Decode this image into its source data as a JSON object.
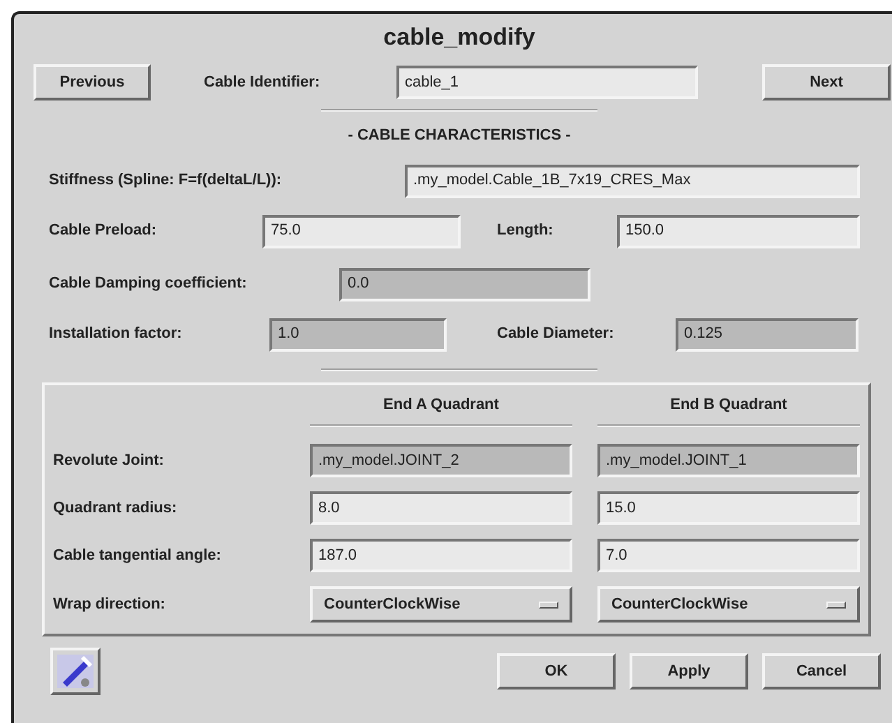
{
  "window": {
    "title": "cable_modify"
  },
  "nav": {
    "previous": "Previous",
    "identifier_label": "Cable Identifier:",
    "identifier": "cable_1",
    "next": "Next"
  },
  "section_title": "- CABLE CHARACTERISTICS -",
  "characteristics": [
    [
      {
        "label": "Stiffness (Spline: F=f(deltaL/L)):",
        "value": ".my_model.Cable_1B_7x19_CRES_Max",
        "editable": true
      }
    ],
    [
      {
        "label": "Cable Preload:",
        "value": "75.0",
        "editable": true
      },
      {
        "label": "Length:",
        "value": "150.0",
        "editable": true
      }
    ],
    [
      {
        "label": "Cable Damping coefficient:",
        "value": "0.0",
        "editable": false
      }
    ],
    [
      {
        "label": "Installation factor:",
        "value": "1.0",
        "editable": false
      },
      {
        "label": "Cable Diameter:",
        "value": "0.125",
        "editable": false
      }
    ]
  ],
  "quadrant": {
    "columns": [
      "End A Quadrant",
      "End B Quadrant"
    ],
    "rows": [
      {
        "label": "Revolute Joint:",
        "kind": "text",
        "values": [
          {
            "value": ".my_model.JOINT_2",
            "editable": false
          },
          {
            "value": ".my_model.JOINT_1",
            "editable": false
          }
        ]
      },
      {
        "label": "Quadrant radius:",
        "kind": "text",
        "values": [
          {
            "value": "8.0",
            "editable": true
          },
          {
            "value": "15.0",
            "editable": true
          }
        ]
      },
      {
        "label": "Cable tangential angle:",
        "kind": "text",
        "values": [
          {
            "value": "187.0",
            "editable": true
          },
          {
            "value": "7.0",
            "editable": true
          }
        ]
      },
      {
        "label": "Wrap direction:",
        "kind": "menu",
        "values": [
          {
            "value": "CounterClockWise"
          },
          {
            "value": "CounterClockWise"
          }
        ]
      }
    ]
  },
  "buttons": [
    "OK",
    "Apply",
    "Cancel"
  ]
}
